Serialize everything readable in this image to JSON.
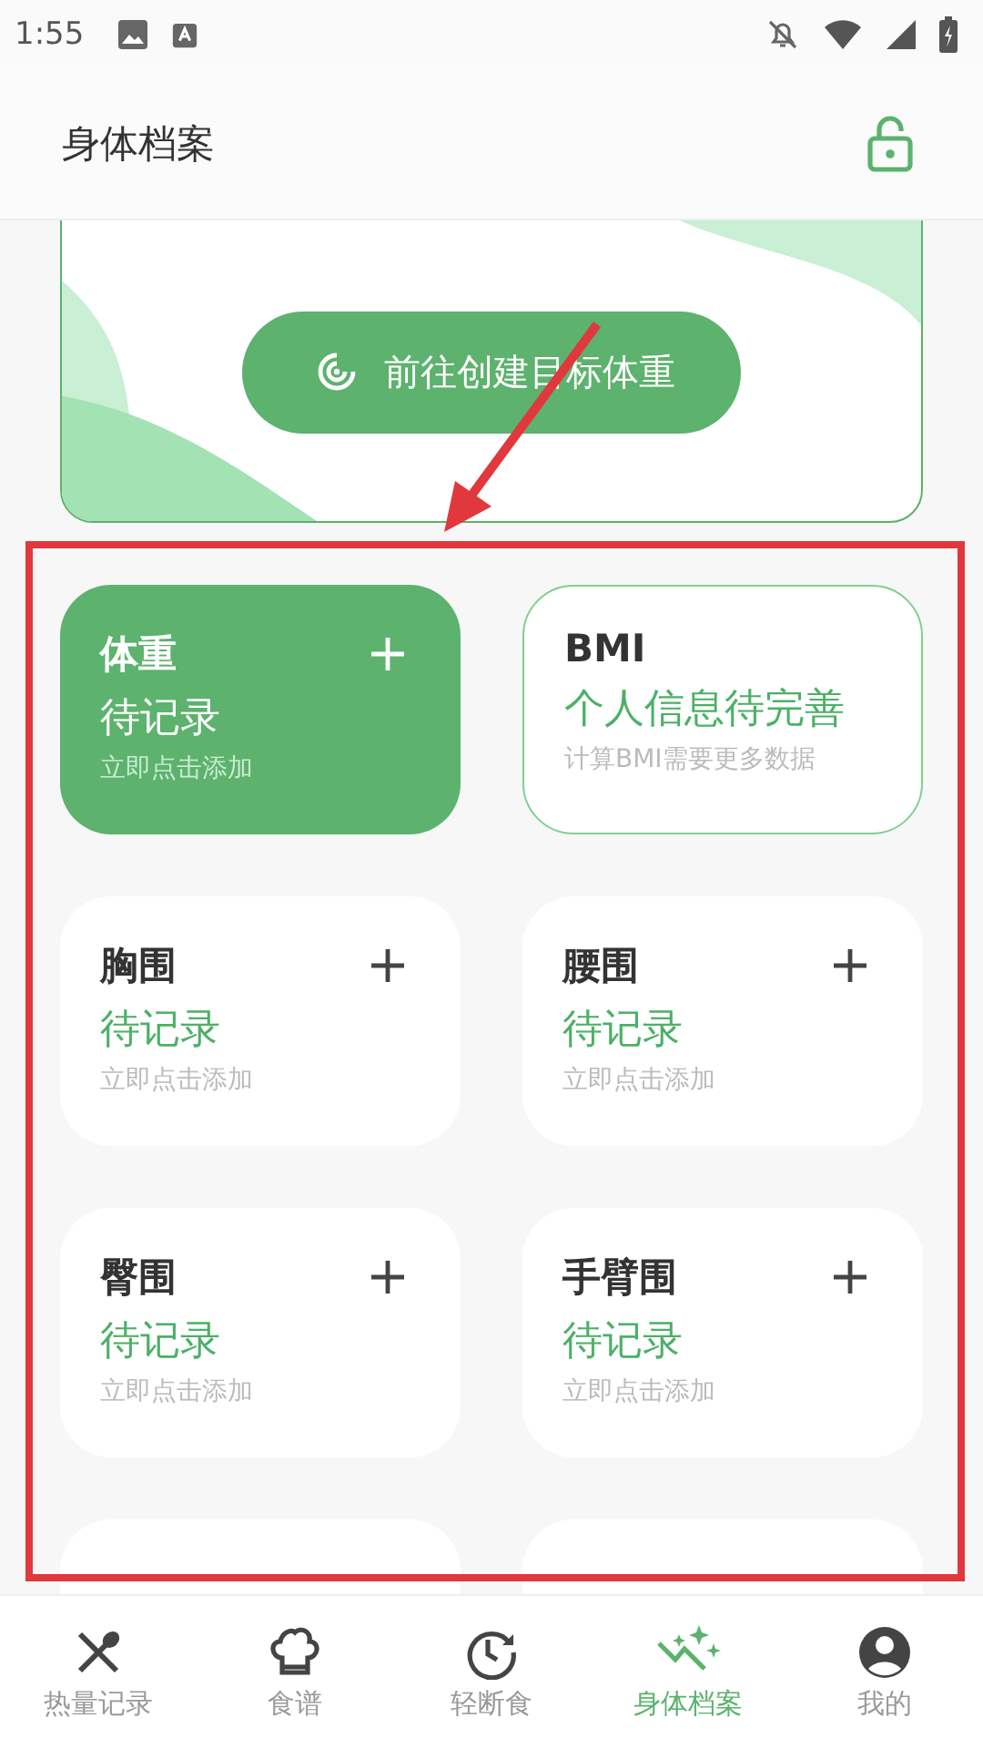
{
  "status_bar": {
    "time": "1:55"
  },
  "header": {
    "title": "身体档案"
  },
  "banner": {
    "button": "前往创建目标体重"
  },
  "cards": [
    {
      "kind": "add",
      "selected": true,
      "title": "体重",
      "status": "待记录",
      "hint": "立即点击添加"
    },
    {
      "kind": "info",
      "selected": false,
      "title": "BMI",
      "status": "个人信息待完善",
      "hint": "计算BMI需要更多数据"
    },
    {
      "kind": "add",
      "selected": false,
      "title": "胸围",
      "status": "待记录",
      "hint": "立即点击添加"
    },
    {
      "kind": "add",
      "selected": false,
      "title": "腰围",
      "status": "待记录",
      "hint": "立即点击添加"
    },
    {
      "kind": "add",
      "selected": false,
      "title": "臀围",
      "status": "待记录",
      "hint": "立即点击添加"
    },
    {
      "kind": "add",
      "selected": false,
      "title": "手臂围",
      "status": "待记录",
      "hint": "立即点击添加"
    },
    {
      "kind": "hidden",
      "selected": false
    },
    {
      "kind": "hidden",
      "selected": false
    }
  ],
  "tabs": [
    {
      "kind": "meals",
      "label": "热量记录",
      "selected": false
    },
    {
      "kind": "recipes",
      "label": "食谱",
      "selected": false
    },
    {
      "kind": "fasting",
      "label": "轻断食",
      "selected": false
    },
    {
      "kind": "body",
      "label": "身体档案",
      "selected": true
    },
    {
      "kind": "profile",
      "label": "我的",
      "selected": false
    }
  ]
}
